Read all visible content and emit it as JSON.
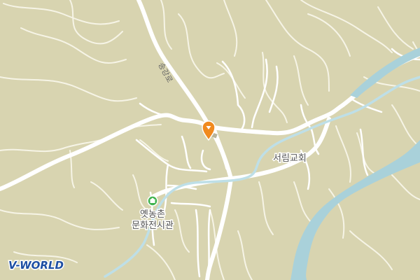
{
  "map": {
    "background_color": "#D8D4B0",
    "road_color": "#FFFFFF",
    "contour_color": "#F6F4E6",
    "river_color": "#A9D1DA",
    "stream_color": "#BEDFE7"
  },
  "labels": {
    "road_name": "송강로",
    "church": "서림교회",
    "museum_line1": "옛농촌",
    "museum_line2": "문화전시관"
  },
  "markers": {
    "pin_icon": "map-pin-icon",
    "pin_color": "#F08A1E",
    "poi_icon": "museum-icon",
    "poi_color": "#3FB34F"
  },
  "watermark": {
    "brand": "V-WORLD",
    "brand_color": "#1E4FA3"
  }
}
